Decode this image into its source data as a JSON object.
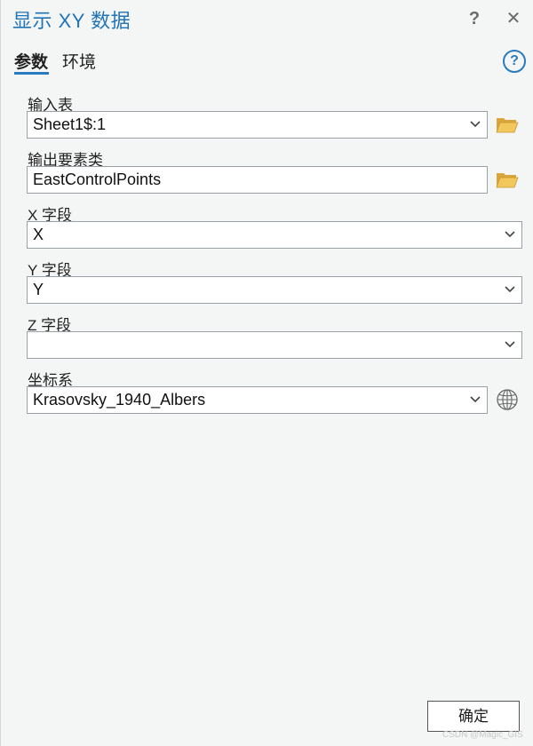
{
  "window": {
    "title": "显示 XY 数据",
    "help_label": "?",
    "close_label": "✕"
  },
  "tabs": [
    {
      "label": "参数"
    },
    {
      "label": "环境"
    }
  ],
  "help_icon_label": "?",
  "params": {
    "input_table": {
      "label": "输入表",
      "value": "Sheet1$:1"
    },
    "output_feature_class": {
      "label": "输出要素类",
      "value": "EastControlPoints"
    },
    "x_field": {
      "label": "X 字段",
      "value": "X"
    },
    "y_field": {
      "label": "Y 字段",
      "value": "Y"
    },
    "z_field": {
      "label": "Z 字段",
      "value": ""
    },
    "coordinate_system": {
      "label": "坐标系",
      "value": "Krasovsky_1940_Albers"
    }
  },
  "footer": {
    "ok_label": "确定",
    "watermark": "CSDN @Magic_GIS"
  },
  "colors": {
    "accent": "#1f73b7",
    "folder": "#e8b84a",
    "background": "#f4f6f5"
  },
  "icons": [
    "folder-icon",
    "globe-icon",
    "chevron-down-icon",
    "help-circle-icon",
    "close-icon"
  ]
}
